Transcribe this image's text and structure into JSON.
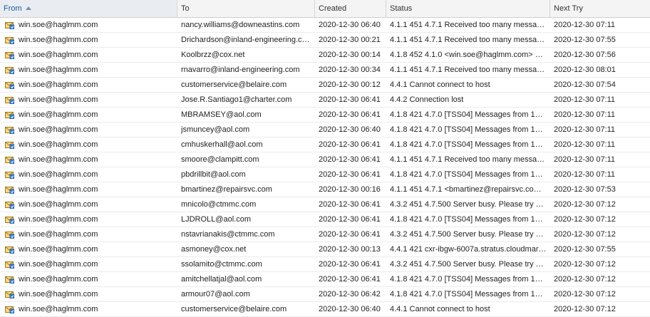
{
  "columns": {
    "from": "From",
    "to": "To",
    "created": "Created",
    "status": "Status",
    "next_try": "Next Try"
  },
  "sort": {
    "column": "From",
    "direction": "ascending"
  },
  "icon": "envelope-queued-icon",
  "rows": [
    {
      "from": "win.soe@haglmm.com",
      "to": "nancy.williams@downeastins.com",
      "created": "2020-12-30 06:40",
      "status": "4.1.1 451 4.7.1 Received too many messa…",
      "next_try": "2020-12-30 07:11"
    },
    {
      "from": "win.soe@haglmm.com",
      "to": "Drichardson@inland-engineering.c…",
      "created": "2020-12-30 00:21",
      "status": "4.1.1 451 4.7.1 Received too many messa…",
      "next_try": "2020-12-30 07:55"
    },
    {
      "from": "win.soe@haglmm.com",
      "to": "Koolbrzz@cox.net",
      "created": "2020-12-30 00:14",
      "status": "4.1.8 452 4.1.0 <win.soe@haglmm.com> …",
      "next_try": "2020-12-30 07:56"
    },
    {
      "from": "win.soe@haglmm.com",
      "to": "rnavarro@inland-engineering.com",
      "created": "2020-12-30 00:34",
      "status": "4.1.1 451 4.7.1 Received too many messa…",
      "next_try": "2020-12-30 08:01"
    },
    {
      "from": "win.soe@haglmm.com",
      "to": "customerservice@belaire.com",
      "created": "2020-12-30 00:12",
      "status": "4.4.1 Cannot connect to host",
      "next_try": "2020-12-30 07:54"
    },
    {
      "from": "win.soe@haglmm.com",
      "to": "Jose.R.Santiago1@charter.com",
      "created": "2020-12-30 06:41",
      "status": "4.4.2 Connection lost",
      "next_try": "2020-12-30 07:11"
    },
    {
      "from": "win.soe@haglmm.com",
      "to": "MBRAMSEY@aol.com",
      "created": "2020-12-30 06:41",
      "status": "4.1.8 421 4.7.0 [TSS04] Messages from 1…",
      "next_try": "2020-12-30 07:11"
    },
    {
      "from": "win.soe@haglmm.com",
      "to": "jsmuncey@aol.com",
      "created": "2020-12-30 06:40",
      "status": "4.1.8 421 4.7.0 [TSS04] Messages from 1…",
      "next_try": "2020-12-30 07:11"
    },
    {
      "from": "win.soe@haglmm.com",
      "to": "cmhuskerhall@aol.com",
      "created": "2020-12-30 06:41",
      "status": "4.1.8 421 4.7.0 [TSS04] Messages from 1…",
      "next_try": "2020-12-30 07:11"
    },
    {
      "from": "win.soe@haglmm.com",
      "to": "smoore@clampitt.com",
      "created": "2020-12-30 06:41",
      "status": "4.1.1 451 4.7.1 Received too many messa…",
      "next_try": "2020-12-30 07:11"
    },
    {
      "from": "win.soe@haglmm.com",
      "to": "pbdrillbit@aol.com",
      "created": "2020-12-30 06:41",
      "status": "4.1.8 421 4.7.0 [TSS04] Messages from 1…",
      "next_try": "2020-12-30 07:11"
    },
    {
      "from": "win.soe@haglmm.com",
      "to": "bmartinez@repairsvc.com",
      "created": "2020-12-30 00:16",
      "status": "4.1.1 451 4.7.1 <bmartinez@repairsvc.co…",
      "next_try": "2020-12-30 07:53"
    },
    {
      "from": "win.soe@haglmm.com",
      "to": "mnicolo@ctmmc.com",
      "created": "2020-12-30 06:41",
      "status": "4.3.2 451 4.7.500 Server busy. Please try …",
      "next_try": "2020-12-30 07:12"
    },
    {
      "from": "win.soe@haglmm.com",
      "to": "LJDROLL@aol.com",
      "created": "2020-12-30 06:41",
      "status": "4.1.8 421 4.7.0 [TSS04] Messages from 1…",
      "next_try": "2020-12-30 07:12"
    },
    {
      "from": "win.soe@haglmm.com",
      "to": "nstavrianakis@ctmmc.com",
      "created": "2020-12-30 06:41",
      "status": "4.3.2 451 4.7.500 Server busy. Please try …",
      "next_try": "2020-12-30 07:12"
    },
    {
      "from": "win.soe@haglmm.com",
      "to": "asmoney@cox.net",
      "created": "2020-12-30 00:13",
      "status": "4.4.1 421 cxr-ibgw-6007a.stratus.cloudmar…",
      "next_try": "2020-12-30 07:55"
    },
    {
      "from": "win.soe@haglmm.com",
      "to": "ssolamito@ctmmc.com",
      "created": "2020-12-30 06:41",
      "status": "4.3.2 451 4.7.500 Server busy. Please try …",
      "next_try": "2020-12-30 07:12"
    },
    {
      "from": "win.soe@haglmm.com",
      "to": "amitchellatjal@aol.com",
      "created": "2020-12-30 06:41",
      "status": "4.1.8 421 4.7.0 [TSS04] Messages from 1…",
      "next_try": "2020-12-30 07:12"
    },
    {
      "from": "win.soe@haglmm.com",
      "to": "armour07@aol.com",
      "created": "2020-12-30 06:42",
      "status": "4.1.8 421 4.7.0 [TSS04] Messages from 1…",
      "next_try": "2020-12-30 07:12"
    },
    {
      "from": "win.soe@haglmm.com",
      "to": "customerservice@belaire.com",
      "created": "2020-12-30 06:40",
      "status": "4.4.1 Cannot connect to host",
      "next_try": "2020-12-30 07:12"
    }
  ]
}
